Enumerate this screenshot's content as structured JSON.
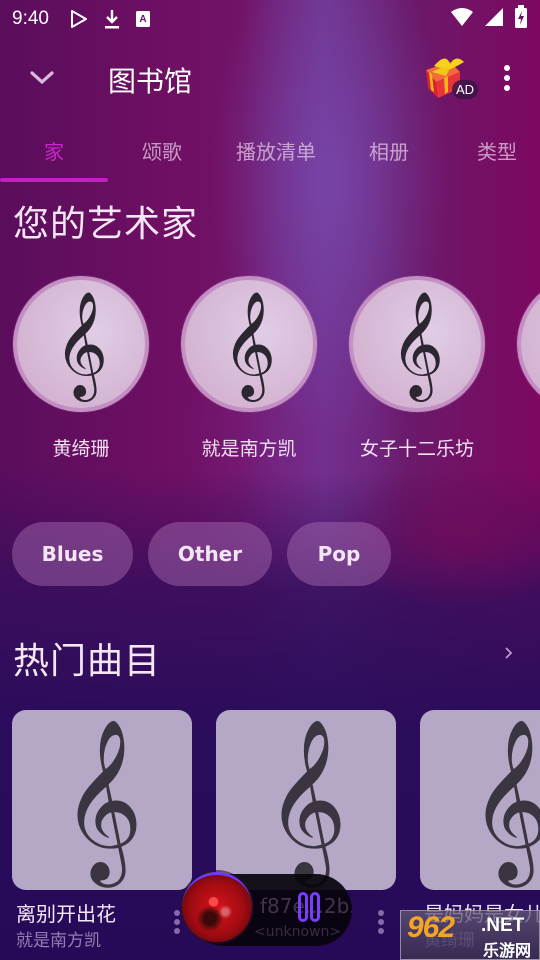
{
  "status_bar": {
    "time": "9:40",
    "left_icons": [
      "play-store-icon",
      "download-icon",
      "keyboard-a-icon"
    ],
    "right_icons": [
      "wifi-icon",
      "signal-icon",
      "battery-charging-icon"
    ]
  },
  "app_bar": {
    "title": "图书馆",
    "back_icon": "chevron-down-icon",
    "gift_icon": "gift-icon",
    "ad_badge": "AD",
    "more_icon": "more-vert-icon"
  },
  "tabs": [
    {
      "label": "家",
      "active": true
    },
    {
      "label": "颂歌",
      "active": false
    },
    {
      "label": "播放清单",
      "active": false
    },
    {
      "label": "相册",
      "active": false
    },
    {
      "label": "类型",
      "active": false
    }
  ],
  "artists_section": {
    "title": "您的艺术家",
    "items": [
      {
        "name": "黄绮珊",
        "icon": "treble-clef-icon"
      },
      {
        "name": "就是南方凯",
        "icon": "treble-clef-icon"
      },
      {
        "name": "女子十二乐坊",
        "icon": "treble-clef-icon"
      }
    ]
  },
  "genres": [
    "Blues",
    "Other",
    "Pop"
  ],
  "top_tracks": {
    "title": "热门曲目",
    "see_more_icon": "chevron-right-icon",
    "items": [
      {
        "title": "离别开出花",
        "artist": "就是南方凯"
      },
      {
        "title": "",
        "artist": ""
      },
      {
        "title": "是妈妈是女儿",
        "artist": "黄绮珊"
      }
    ]
  },
  "mini_player": {
    "title": "f87e...2b...",
    "subtitle": "<unknown>",
    "state_icon": "pause-icon"
  },
  "watermark": {
    "number": "962",
    "suffix": ".NET",
    "cn": "乐游网"
  },
  "colors": {
    "accent": "#c41fc6",
    "tab_active": "#c826c9",
    "pause_accent": "#7a3cff"
  }
}
